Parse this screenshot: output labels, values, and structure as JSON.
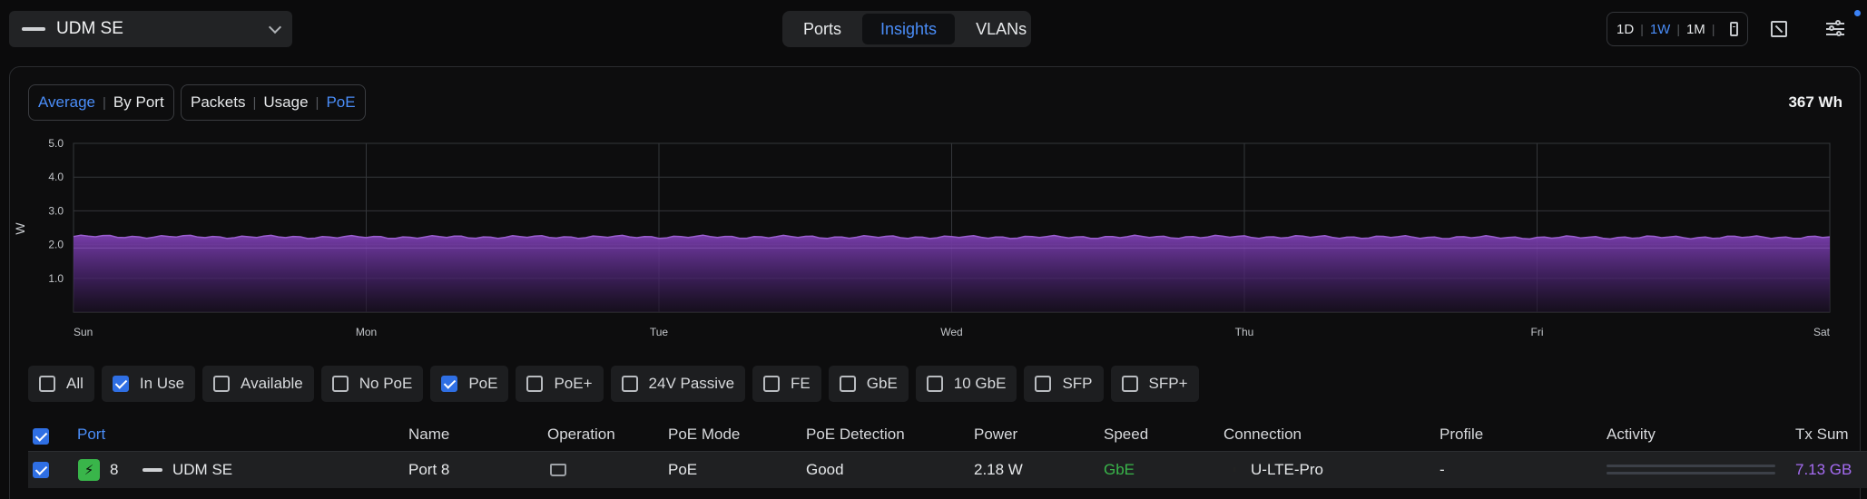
{
  "device_selector": {
    "name": "UDM SE"
  },
  "view_tabs": [
    {
      "label": "Ports",
      "active": false
    },
    {
      "label": "Insights",
      "active": true
    },
    {
      "label": "VLANs",
      "active": false
    }
  ],
  "time_range": {
    "options": [
      "1D",
      "1W",
      "1M"
    ],
    "selected": "1W"
  },
  "mode_toggle": {
    "options": [
      "Average",
      "By Port"
    ],
    "selected": "Average"
  },
  "metric_toggle": {
    "options": [
      "Packets",
      "Usage",
      "PoE"
    ],
    "selected": "PoE"
  },
  "total_energy": "367 Wh",
  "chart_data": {
    "type": "area",
    "ylabel": "W",
    "ylim": [
      0,
      5
    ],
    "y_ticks": [
      "1.0",
      "2.0",
      "3.0",
      "4.0",
      "5.0"
    ],
    "x_ticks": [
      "Sun",
      "Mon",
      "Tue",
      "Wed",
      "Thu",
      "Fri",
      "Sat"
    ],
    "grid": true,
    "series": [
      {
        "color": "#7c3fb0",
        "x": [
          "Sun",
          "Mon",
          "Tue",
          "Wed",
          "Thu",
          "Fri",
          "Sat"
        ],
        "values": [
          2.24,
          2.22,
          2.23,
          2.22,
          2.23,
          2.21,
          2.22
        ]
      }
    ]
  },
  "filters": [
    {
      "label": "All",
      "checked": false
    },
    {
      "label": "In Use",
      "checked": true
    },
    {
      "label": "Available",
      "checked": false
    },
    {
      "label": "No PoE",
      "checked": false
    },
    {
      "label": "PoE",
      "checked": true
    },
    {
      "label": "PoE+",
      "checked": false
    },
    {
      "label": "24V Passive",
      "checked": false
    },
    {
      "label": "FE",
      "checked": false
    },
    {
      "label": "GbE",
      "checked": false
    },
    {
      "label": "10 GbE",
      "checked": false
    },
    {
      "label": "SFP",
      "checked": false
    },
    {
      "label": "SFP+",
      "checked": false
    }
  ],
  "table": {
    "headers": {
      "port": "Port",
      "name": "Name",
      "operation": "Operation",
      "poe_mode": "PoE Mode",
      "poe_detection": "PoE Detection",
      "power": "Power",
      "speed": "Speed",
      "connection": "Connection",
      "profile": "Profile",
      "activity": "Activity",
      "tx_sum": "Tx Sum"
    },
    "rows": [
      {
        "checked": true,
        "port": "8",
        "device": "UDM SE",
        "name": "Port 8",
        "poe_mode": "PoE",
        "poe_detection": "Good",
        "power": "2.18 W",
        "speed": "GbE",
        "connection": "U-LTE-Pro",
        "profile": "-",
        "tx_sum": "7.13 GB"
      }
    ]
  },
  "colors": {
    "accent": "#4a8df8",
    "poe_green": "#39b54a",
    "series_purple": "#7c3fb0",
    "tx_purple": "#a56cf2"
  }
}
